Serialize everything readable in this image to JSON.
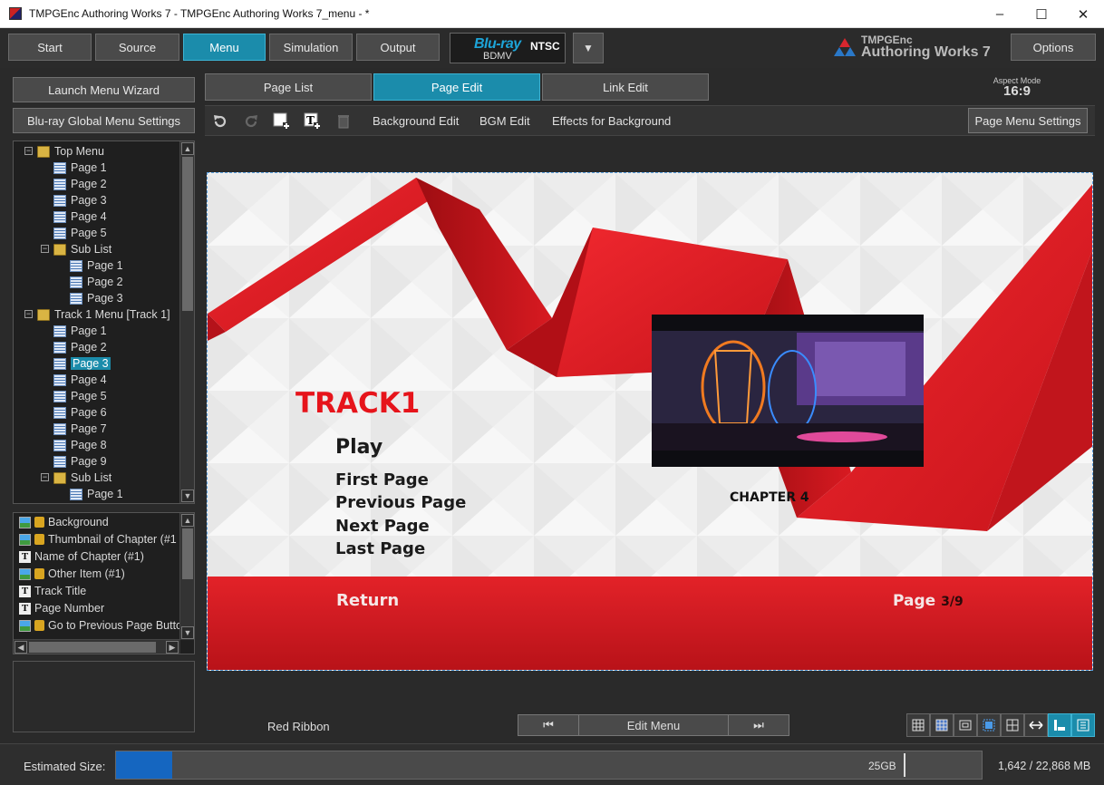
{
  "window": {
    "title": "TMPGEnc Authoring Works 7 - TMPGEnc Authoring Works 7_menu - *",
    "minimize": "–",
    "maximize": "☐",
    "close": "✕"
  },
  "topbar": {
    "steps": [
      "Start",
      "Source",
      "Menu",
      "Simulation",
      "Output"
    ],
    "active_step": "Menu",
    "format_logo": "Blu-ray",
    "format_sub": "BDMV",
    "format_standard": "NTSC",
    "dropdown_glyph": "▼",
    "brand_line1": "TMPGEnc",
    "brand_line2": "Authoring Works 7",
    "options_label": "Options"
  },
  "left": {
    "wizard_label": "Launch Menu Wizard",
    "global_settings_label": "Blu-ray Global Menu Settings",
    "tree": [
      {
        "label": "Top Menu",
        "type": "folder",
        "level": 0,
        "expander": "−"
      },
      {
        "label": "Page 1",
        "type": "page",
        "level": 1
      },
      {
        "label": "Page 2",
        "type": "page",
        "level": 1
      },
      {
        "label": "Page 3",
        "type": "page",
        "level": 1
      },
      {
        "label": "Page 4",
        "type": "page",
        "level": 1
      },
      {
        "label": "Page 5",
        "type": "page",
        "level": 1
      },
      {
        "label": "Sub List",
        "type": "folder",
        "level": 1,
        "expander": "−"
      },
      {
        "label": "Page 1",
        "type": "page",
        "level": 2
      },
      {
        "label": "Page 2",
        "type": "page",
        "level": 2
      },
      {
        "label": "Page 3",
        "type": "page",
        "level": 2
      },
      {
        "label": "Track 1 Menu [Track 1]",
        "type": "folder",
        "level": 0,
        "expander": "−"
      },
      {
        "label": "Page 1",
        "type": "page",
        "level": 1
      },
      {
        "label": "Page 2",
        "type": "page",
        "level": 1
      },
      {
        "label": "Page 3",
        "type": "page",
        "level": 1,
        "selected": true
      },
      {
        "label": "Page 4",
        "type": "page",
        "level": 1
      },
      {
        "label": "Page 5",
        "type": "page",
        "level": 1
      },
      {
        "label": "Page 6",
        "type": "page",
        "level": 1
      },
      {
        "label": "Page 7",
        "type": "page",
        "level": 1
      },
      {
        "label": "Page 8",
        "type": "page",
        "level": 1
      },
      {
        "label": "Page 9",
        "type": "page",
        "level": 1
      },
      {
        "label": "Sub List",
        "type": "folder",
        "level": 1,
        "expander": "−"
      },
      {
        "label": "Page 1",
        "type": "page",
        "level": 2
      }
    ],
    "layers": [
      {
        "label": "Background",
        "icon": "image",
        "locked": true
      },
      {
        "label": "Thumbnail of Chapter (#1",
        "icon": "image",
        "locked": true
      },
      {
        "label": "Name of Chapter (#1)",
        "icon": "text",
        "locked": false
      },
      {
        "label": "Other Item (#1)",
        "icon": "image",
        "locked": true
      },
      {
        "label": "Track Title",
        "icon": "text",
        "locked": false
      },
      {
        "label": "Page Number",
        "icon": "text",
        "locked": false
      },
      {
        "label": "Go to Previous Page Butto",
        "icon": "image",
        "locked": true
      }
    ]
  },
  "tabs": {
    "items": [
      "Page List",
      "Page Edit",
      "Link Edit"
    ],
    "active": "Page Edit"
  },
  "aspect": {
    "label": "Aspect Mode",
    "value": "16:9"
  },
  "edit_toolbar": {
    "icons": [
      "undo-icon",
      "redo-icon",
      "add-image-icon",
      "add-text-icon",
      "delete-icon"
    ],
    "links": [
      "Background Edit",
      "BGM Edit",
      "Effects for Background"
    ],
    "page_menu_settings": "Page Menu Settings"
  },
  "menu_page": {
    "track_title": "TRACK1",
    "play": "Play",
    "nav_buttons": [
      "First Page",
      "Previous Page",
      "Next Page",
      "Last Page"
    ],
    "chapter_name": "CHAPTER 4",
    "return": "Return",
    "page_label": "Page",
    "page_current": "3/9",
    "colors": {
      "ribbon": "#e3161d",
      "band": "#d21c22",
      "background": "#f2f2f2"
    }
  },
  "bottom": {
    "template_name": "Red Ribbon",
    "prev_glyph": "⏮",
    "edit_menu": "Edit Menu",
    "next_glyph": "⏭",
    "view_icons": [
      "grid-icon",
      "grid-fine-icon",
      "tv-safe-icon",
      "safe-area-icon",
      "layout-icon",
      "fit-width-icon",
      "layer-view-icon",
      "thumbnail-view-icon"
    ]
  },
  "status": {
    "estimated_label": "Estimated Size:",
    "capacity_label": "25GB",
    "used_fraction": 0.065,
    "readout": "1,642 / 22,868 MB"
  }
}
